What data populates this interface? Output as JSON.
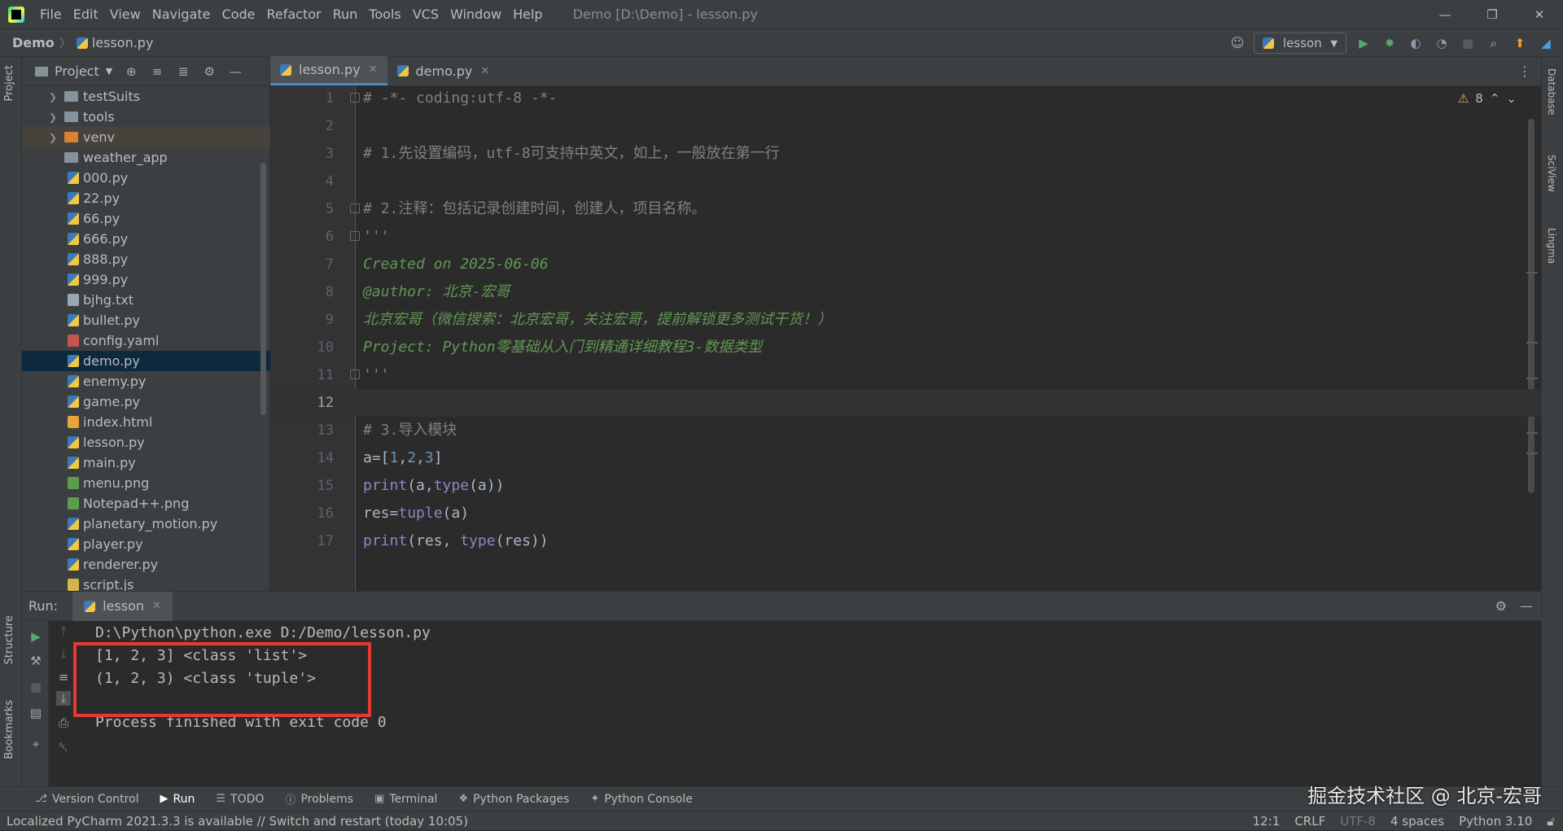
{
  "menubar": {
    "items": [
      "File",
      "Edit",
      "View",
      "Navigate",
      "Code",
      "Refactor",
      "Run",
      "Tools",
      "VCS",
      "Window",
      "Help"
    ],
    "window_title": "Demo [D:\\Demo] - lesson.py"
  },
  "navbar": {
    "project": "Demo",
    "file": "lesson.py",
    "run_config": "lesson"
  },
  "left_strip": {
    "project_label": "Project",
    "structure_label": "Structure",
    "bookmarks_label": "Bookmarks"
  },
  "right_strip": {
    "database_label": "Database",
    "sciview_label": "SciView",
    "lingma_label": "Lingma"
  },
  "project_panel": {
    "title": "Project",
    "tree": [
      {
        "name": "testSuits",
        "type": "folder",
        "expandable": true
      },
      {
        "name": "tools",
        "type": "folder",
        "expandable": true
      },
      {
        "name": "venv",
        "type": "folder-orange",
        "expandable": true
      },
      {
        "name": "weather_app",
        "type": "folder",
        "expandable": false
      },
      {
        "name": "000.py",
        "type": "py"
      },
      {
        "name": "22.py",
        "type": "py"
      },
      {
        "name": "66.py",
        "type": "py"
      },
      {
        "name": "666.py",
        "type": "py"
      },
      {
        "name": "888.py",
        "type": "py"
      },
      {
        "name": "999.py",
        "type": "py"
      },
      {
        "name": "bjhg.txt",
        "type": "txt"
      },
      {
        "name": "bullet.py",
        "type": "py"
      },
      {
        "name": "config.yaml",
        "type": "yaml"
      },
      {
        "name": "demo.py",
        "type": "py",
        "selected": true
      },
      {
        "name": "enemy.py",
        "type": "py"
      },
      {
        "name": "game.py",
        "type": "py"
      },
      {
        "name": "index.html",
        "type": "html"
      },
      {
        "name": "lesson.py",
        "type": "py"
      },
      {
        "name": "main.py",
        "type": "py"
      },
      {
        "name": "menu.png",
        "type": "png"
      },
      {
        "name": "Notepad++.png",
        "type": "png"
      },
      {
        "name": "planetary_motion.py",
        "type": "py"
      },
      {
        "name": "player.py",
        "type": "py"
      },
      {
        "name": "renderer.py",
        "type": "py"
      },
      {
        "name": "script.js",
        "type": "js"
      }
    ]
  },
  "editor": {
    "tabs": [
      {
        "label": "lesson.py",
        "active": true
      },
      {
        "label": "demo.py",
        "active": false
      }
    ],
    "inspection_count": "8",
    "current_line": 12,
    "lines": [
      {
        "n": "1",
        "text": "# -*- coding:utf-8 -*-",
        "style": "comment",
        "fold": true
      },
      {
        "n": "2",
        "text": "",
        "style": "id"
      },
      {
        "n": "3",
        "text": "# 1.先设置编码，utf-8可支持中英文，如上，一般放在第一行",
        "style": "comment"
      },
      {
        "n": "4",
        "text": "",
        "style": "id"
      },
      {
        "n": "5",
        "text": "# 2.注释：包括记录创建时间，创建人，项目名称。",
        "style": "comment",
        "fold": true
      },
      {
        "n": "6",
        "text": "'''",
        "style": "doc",
        "fold": true
      },
      {
        "n": "7",
        "text": "Created on 2025-06-06",
        "style": "doc"
      },
      {
        "n": "8",
        "text": "@author: 北京-宏哥",
        "style": "doc"
      },
      {
        "n": "9",
        "text": "北京宏哥（微信搜索：北京宏哥，关注宏哥，提前解锁更多测试干货！）",
        "style": "doc"
      },
      {
        "n": "10",
        "text": "Project: Python零基础从入门到精通详细教程3-数据类型",
        "style": "doc"
      },
      {
        "n": "11",
        "text": "'''",
        "style": "doc",
        "fold": true
      },
      {
        "n": "12",
        "text": "",
        "style": "id"
      },
      {
        "n": "13",
        "text": "# 3.导入模块",
        "style": "comment"
      },
      {
        "n": "14",
        "text": "a=[1,2,3]",
        "style": "code"
      },
      {
        "n": "15",
        "text": "print(a,type(a))",
        "style": "code"
      },
      {
        "n": "16",
        "text": "res=tuple(a)",
        "style": "code"
      },
      {
        "n": "17",
        "text": "print(res, type(res))",
        "style": "code"
      }
    ]
  },
  "run_panel": {
    "label": "Run:",
    "tab": "lesson",
    "console": [
      "D:\\Python\\python.exe D:/Demo/lesson.py",
      "[1, 2, 3] <class 'list'>",
      "(1, 2, 3) <class 'tuple'>",
      "",
      "Process finished with exit code 0"
    ]
  },
  "bottom_tabs": [
    "Version Control",
    "Run",
    "TODO",
    "Problems",
    "Terminal",
    "Python Packages",
    "Python Console"
  ],
  "statusbar": {
    "message": "Localized PyCharm 2021.3.3 is available // Switch and restart (today 10:05)",
    "position": "12:1",
    "line_sep": "CRLF",
    "encoding": "UTF-8",
    "indent": "4 spaces",
    "interpreter": "Python 3.10"
  },
  "watermark": "掘金技术社区 @ 北京-宏哥"
}
